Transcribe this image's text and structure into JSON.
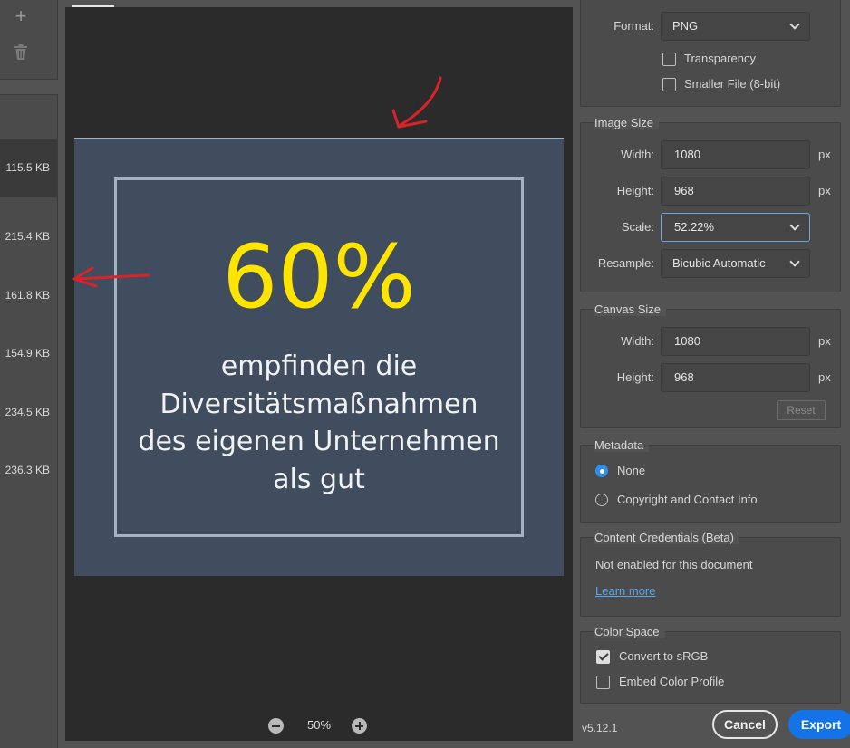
{
  "left": {
    "sizes": [
      "115.5 KB",
      "215.4 KB",
      "161.8 KB",
      "154.9 KB",
      "234.5 KB",
      "236.3 KB"
    ],
    "selected_index": 0
  },
  "preview": {
    "slide": {
      "percent": "60%",
      "lines": [
        "empfinden die",
        "Diversitätsmaßnahmen",
        "des eigenen Unternehmen",
        "als gut"
      ],
      "background": "#3f4d5e",
      "highlight": "#ffe400"
    },
    "zoom": "50%"
  },
  "format": {
    "label": "Format:",
    "value": "PNG",
    "transparency": {
      "label": "Transparency",
      "checked": false
    },
    "smaller_file": {
      "label": "Smaller File (8-bit)",
      "checked": false
    }
  },
  "image_size": {
    "title": "Image Size",
    "width_label": "Width:",
    "width": "1080",
    "height_label": "Height:",
    "height": "968",
    "unit": "px",
    "scale_label": "Scale:",
    "scale": "52.22%",
    "resample_label": "Resample:",
    "resample": "Bicubic Automatic"
  },
  "canvas_size": {
    "title": "Canvas Size",
    "width_label": "Width:",
    "width": "1080",
    "height_label": "Height:",
    "height": "968",
    "unit": "px",
    "reset": "Reset"
  },
  "metadata": {
    "title": "Metadata",
    "none": "None",
    "copyright": "Copyright and Contact Info",
    "selected": "None"
  },
  "content_credentials": {
    "title": "Content Credentials (Beta)",
    "status": "Not enabled for this document",
    "link": "Learn more"
  },
  "color_space": {
    "title": "Color Space",
    "convert": {
      "label": "Convert to sRGB",
      "checked": true
    },
    "embed": {
      "label": "Embed Color Profile",
      "checked": false
    }
  },
  "footer": {
    "version": "v5.12.1",
    "cancel": "Cancel",
    "export": "Export"
  },
  "colors": {
    "accent": "#1473e6",
    "annotation": "#d9232a"
  }
}
